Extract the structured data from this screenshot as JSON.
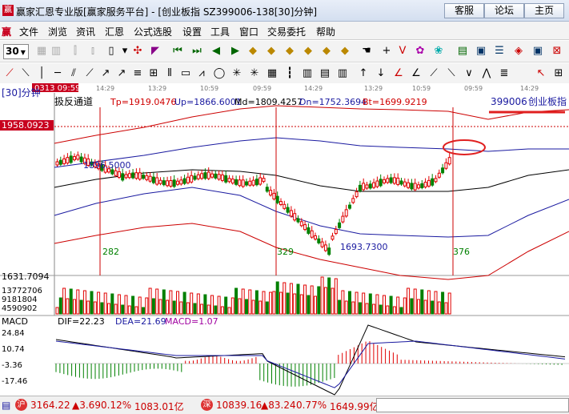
{
  "window": {
    "title": "赢家汇恩专业版[赢家服务平台] - [创业板指   SZ399006-138[30]分钟]",
    "buttons": [
      "客服",
      "论坛",
      "主页"
    ]
  },
  "menu": {
    "logo": "赢",
    "items": [
      "文件",
      "浏览",
      "资讯",
      "汇恩",
      "公式选股",
      "设置",
      "工具",
      "窗口",
      "交易委托",
      "帮助"
    ]
  },
  "toolbar": {
    "period": "30"
  },
  "chart": {
    "period_label": "[30]分钟",
    "indicator_name": "扱反通道",
    "tp": "Tp=1919.0476",
    "up": "Up=1866.6001",
    "md": "Md=1809.4257",
    "dn": "Dn=1752.3694",
    "bt": "Bt=1699.9219",
    "stock_code": "399006",
    "stock_name": "创业板指",
    "price_cursor": "1958.0923",
    "time_cursor": "0313 09:59",
    "axis_times": [
      "14:29",
      "13:29",
      "10:59",
      "09:59",
      "14:29",
      "13:29",
      "10:59",
      "09:59",
      "14:29"
    ],
    "price_min": "1631.7094",
    "high_label": "1896.5000",
    "low_label": "1693.7300",
    "bar_counts": [
      "282",
      "329",
      "376"
    ],
    "volume_ticks": [
      "13772706",
      "9181804",
      "4590902"
    ],
    "macd_title": "MACD",
    "dif": "DIF=22.23",
    "dea": "DEA=21.69",
    "macd": "MACD=1.07",
    "macd_ticks": [
      "24.84",
      "10.74",
      "-3.36",
      "-17.46"
    ],
    "colors": {
      "up": "#e00000",
      "down": "#008000",
      "band_red": "#cc0000",
      "band_blue": "#1a1aa0"
    }
  },
  "status": {
    "idx1_value": "3164.22",
    "idx1_change": "▲3.69",
    "idx1_pct": "0.12%",
    "idx1_amount": "1083.01亿",
    "idx2_value": "10839.16",
    "idx2_change": "▲83.24",
    "idx2_pct": "0.77%",
    "idx2_amount": "1649.99亿"
  }
}
